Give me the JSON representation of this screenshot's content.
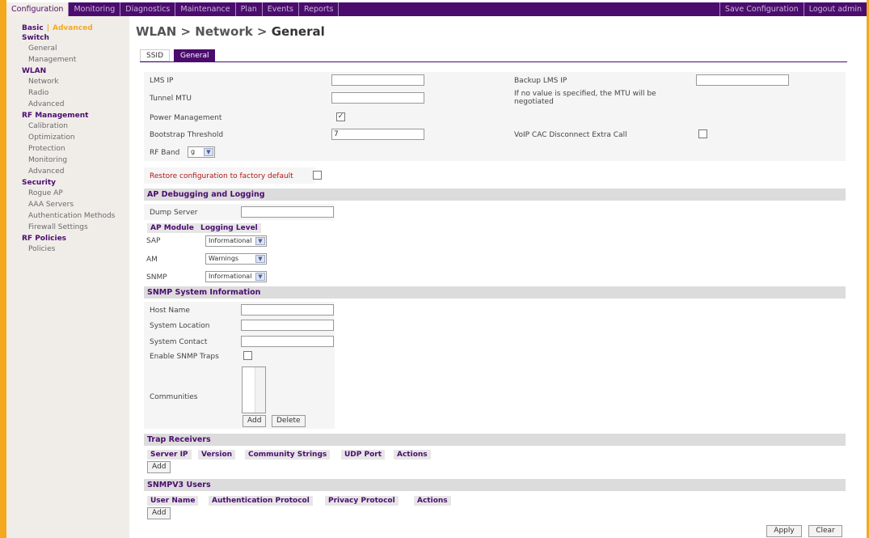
{
  "topnav": {
    "tabs": [
      "Configuration",
      "Monitoring",
      "Diagnostics",
      "Maintenance",
      "Plan",
      "Events",
      "Reports"
    ],
    "save_label": "Save Configuration",
    "logout_label": "Logout admin"
  },
  "sidebar": {
    "basic": "Basic",
    "separator": "|",
    "advanced": "Advanced",
    "groups": [
      {
        "title": "Switch",
        "items": [
          "General",
          "Management"
        ]
      },
      {
        "title": "WLAN",
        "items": [
          "Network",
          "Radio",
          "Advanced"
        ]
      },
      {
        "title": "RF Management",
        "items": [
          "Calibration",
          "Optimization",
          "Protection",
          "Monitoring",
          "Advanced"
        ]
      },
      {
        "title": "Security",
        "items": [
          "Rogue AP",
          "AAA Servers",
          "Authentication Methods",
          "Firewall Settings"
        ]
      },
      {
        "title": "RF Policies",
        "items": [
          "Policies"
        ]
      }
    ]
  },
  "page": {
    "breadcrumb_prefix": "WLAN > Network > ",
    "breadcrumb_current": "General",
    "subtabs": [
      "SSID",
      "General"
    ]
  },
  "form": {
    "lms_ip_label": "LMS IP",
    "lms_ip_value": "",
    "backup_lms_label": "Backup LMS IP",
    "backup_lms_value": "",
    "tunnel_mtu_label": "Tunnel MTU",
    "tunnel_mtu_value": "",
    "mtu_note": "If no value is specified, the MTU will be negotiated",
    "power_mgmt_label": "Power Management",
    "power_mgmt_checked": "✓",
    "bootstrap_label": "Bootstrap Threshold",
    "bootstrap_value": "7",
    "voip_label": "VoIP CAC Disconnect Extra Call",
    "rf_band_label": "RF Band",
    "rf_band_value": "g",
    "restore_label": "Restore configuration to factory default"
  },
  "ap_debug": {
    "title": "AP Debugging and Logging",
    "dump_server_label": "Dump Server",
    "col_module": "AP Module",
    "col_level": "Logging Level",
    "modules": [
      {
        "name": "SAP",
        "level": "Informational"
      },
      {
        "name": "AM",
        "level": "Warnings"
      },
      {
        "name": "SNMP",
        "level": "Informational"
      }
    ]
  },
  "snmp": {
    "title": "SNMP System Information",
    "host_label": "Host Name",
    "location_label": "System Location",
    "contact_label": "System Contact",
    "traps_label": "Enable SNMP Traps",
    "communities_label": "Communities",
    "add_label": "Add",
    "delete_label": "Delete"
  },
  "trap_receivers": {
    "title": "Trap Receivers",
    "columns": [
      "Server IP",
      "Version",
      "Community Strings",
      "UDP Port",
      "Actions"
    ],
    "add_label": "Add"
  },
  "snmpv3": {
    "title": "SNMPV3 Users",
    "columns": [
      "User Name",
      "Authentication Protocol",
      "Privacy Protocol",
      "Actions"
    ],
    "add_label": "Add"
  },
  "footer": {
    "apply_label": "Apply",
    "clear_label": "Clear"
  },
  "colors": {
    "brand_purple": "#4b0c6e",
    "frame_orange": "#f3a81d"
  }
}
